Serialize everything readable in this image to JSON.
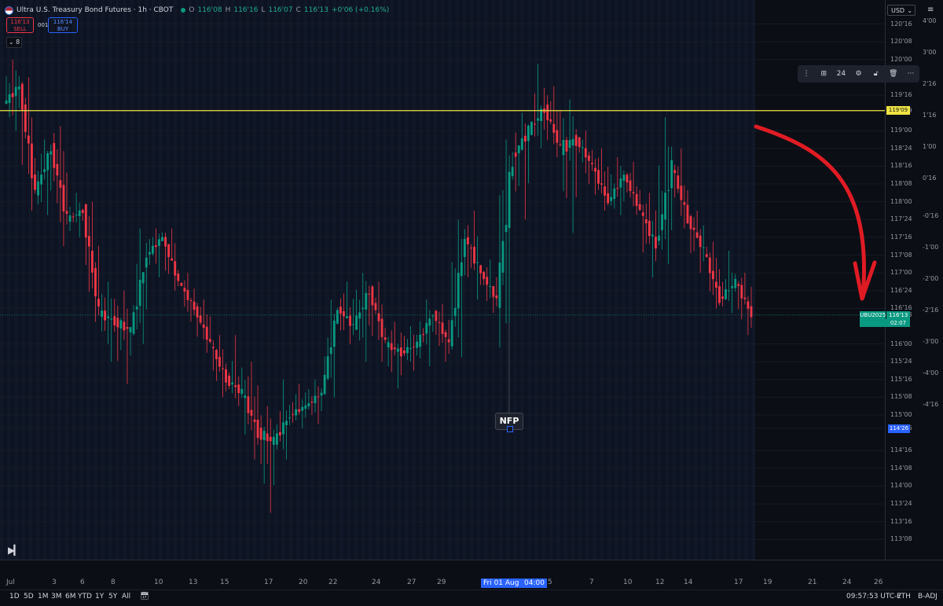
{
  "legend": {
    "title": "Ultra U.S. Treasury Bond Futures · 1h · CBOT",
    "open_label": "O",
    "open": "116'08",
    "high_label": "H",
    "high": "116'16",
    "low_label": "L",
    "low": "116'07",
    "close_label": "C",
    "close": "116'13",
    "change": "+0'06 (+0.16%)"
  },
  "trade": {
    "sell_price": "116'13",
    "sell_label": "SELL",
    "spread": "001",
    "buy_price": "116'14",
    "buy_label": "BUY",
    "indicator_count": "8"
  },
  "currency": "USD",
  "toolbar": {
    "line_width": "24"
  },
  "colors": {
    "background": "#0b0e14",
    "up": "#089981",
    "down": "#f23645",
    "horizontal_line": "#f0e442",
    "arrow": "#e01b24",
    "session_band": "#101828",
    "accent": "#2962ff"
  },
  "chart_data": {
    "type": "candlestick",
    "title": "Ultra U.S. Treasury Bond Futures · 1h · CBOT",
    "y_unit": "32nds of a point",
    "ylim": [
      "113'04",
      "120'24"
    ],
    "y_ticks": [
      "120'16",
      "120'08",
      "120'00",
      "119'16",
      "119'09",
      "119'00",
      "118'24",
      "118'16",
      "118'08",
      "118'00",
      "117'24",
      "117'16",
      "117'08",
      "117'00",
      "116'24",
      "116'16",
      "116'13",
      "116'00",
      "115'24",
      "115'16",
      "115'08",
      "115'00",
      "114'26",
      "114'16",
      "114'08",
      "114'00",
      "113'24",
      "113'16",
      "113'08"
    ],
    "y2_ticks": [
      "4'00",
      "3'00",
      "2'16",
      "1'16",
      "1'00",
      "0'16",
      "-0'16",
      "-1'00",
      "-2'00",
      "-2'16",
      "-3'00",
      "-4'00",
      "-4'16"
    ],
    "x_ticks": [
      "Jul",
      "3",
      "6",
      "8",
      "10",
      "13",
      "15",
      "17",
      "20",
      "22",
      "24",
      "27",
      "29",
      "Fri 01 Aug '25",
      "04:00",
      "5",
      "7",
      "10",
      "12",
      "14",
      "17",
      "19",
      "21",
      "24",
      "26"
    ],
    "series": [
      {
        "x": "Jul 1",
        "open": "119'12",
        "high": "120'00",
        "low": "119'00",
        "close": "119'20"
      },
      {
        "x": "Jul 2",
        "open": "119'20",
        "high": "119'24",
        "low": "117'28",
        "close": "118'04"
      },
      {
        "x": "Jul 3",
        "open": "118'04",
        "high": "118'28",
        "low": "117'26",
        "close": "118'24"
      },
      {
        "x": "Jul 4",
        "open": "118'24",
        "high": "119'02",
        "low": "117'12",
        "close": "117'24"
      },
      {
        "x": "Jul 5",
        "open": "117'24",
        "high": "118'04",
        "low": "117'16",
        "close": "117'28"
      },
      {
        "x": "Jul 6",
        "open": "117'28",
        "high": "118'00",
        "low": "116'10",
        "close": "116'14"
      },
      {
        "x": "Jul 7",
        "open": "116'14",
        "high": "116'28",
        "low": "115'24",
        "close": "116'10"
      },
      {
        "x": "Jul 8",
        "open": "116'10",
        "high": "116'24",
        "low": "115'14",
        "close": "116'06"
      },
      {
        "x": "Jul 9",
        "open": "116'06",
        "high": "117'20",
        "low": "116'00",
        "close": "117'08"
      },
      {
        "x": "Jul 10",
        "open": "117'08",
        "high": "117'20",
        "low": "116'30",
        "close": "117'16"
      },
      {
        "x": "Jul 11",
        "open": "117'16",
        "high": "117'20",
        "low": "116'24",
        "close": "116'28"
      },
      {
        "x": "Jul 12",
        "open": "116'28",
        "high": "117'00",
        "low": "116'10",
        "close": "116'16"
      },
      {
        "x": "Jul 13",
        "open": "116'16",
        "high": "116'20",
        "low": "115'28",
        "close": "116'00"
      },
      {
        "x": "Jul 14",
        "open": "116'00",
        "high": "116'04",
        "low": "115'08",
        "close": "115'16"
      },
      {
        "x": "Jul 15",
        "open": "115'16",
        "high": "116'04",
        "low": "115'04",
        "close": "115'10"
      },
      {
        "x": "Jul 16",
        "open": "115'10",
        "high": "115'24",
        "low": "114'12",
        "close": "114'24"
      },
      {
        "x": "Jul 16b",
        "open": "114'24",
        "high": "115'04",
        "low": "113'20",
        "close": "114'20"
      },
      {
        "x": "Jul 17",
        "open": "114'20",
        "high": "115'16",
        "low": "114'12",
        "close": "115'00"
      },
      {
        "x": "Jul 18",
        "open": "115'00",
        "high": "115'14",
        "low": "114'26",
        "close": "115'04"
      },
      {
        "x": "Jul 20",
        "open": "115'04",
        "high": "115'16",
        "low": "114'28",
        "close": "115'10"
      },
      {
        "x": "Jul 21",
        "open": "115'10",
        "high": "116'20",
        "low": "115'08",
        "close": "116'16"
      },
      {
        "x": "Jul 22",
        "open": "116'16",
        "high": "116'28",
        "low": "116'00",
        "close": "116'08"
      },
      {
        "x": "Jul 23",
        "open": "116'08",
        "high": "117'00",
        "low": "115'24",
        "close": "116'24"
      },
      {
        "x": "Jul 24",
        "open": "116'24",
        "high": "116'28",
        "low": "115'24",
        "close": "116'00"
      },
      {
        "x": "Jul 25",
        "open": "116'00",
        "high": "116'10",
        "low": "115'12",
        "close": "115'28"
      },
      {
        "x": "Jul 27",
        "open": "115'28",
        "high": "116'08",
        "low": "115'20",
        "close": "116'00"
      },
      {
        "x": "Jul 28",
        "open": "116'00",
        "high": "116'20",
        "low": "115'22",
        "close": "116'14"
      },
      {
        "x": "Jul 29",
        "open": "116'14",
        "high": "116'18",
        "low": "115'24",
        "close": "116'00"
      },
      {
        "x": "Jul 30",
        "open": "116'00",
        "high": "117'24",
        "low": "115'26",
        "close": "117'16"
      },
      {
        "x": "Jul 31",
        "open": "117'16",
        "high": "117'28",
        "low": "116'20",
        "close": "117'00"
      },
      {
        "x": "Aug 1 am",
        "open": "117'00",
        "high": "117'06",
        "low": "116'14",
        "close": "116'20"
      },
      {
        "x": "Aug 1 NFP",
        "open": "116'20",
        "high": "118'28",
        "low": "115'08",
        "close": "118'20"
      },
      {
        "x": "Aug 4",
        "open": "118'20",
        "high": "119'08",
        "low": "117'24",
        "close": "119'00"
      },
      {
        "x": "Aug 5",
        "open": "119'00",
        "high": "119'30",
        "low": "118'24",
        "close": "119'10"
      },
      {
        "x": "Aug 6",
        "open": "119'10",
        "high": "119'20",
        "low": "118'20",
        "close": "118'24"
      },
      {
        "x": "Aug 7",
        "open": "118'24",
        "high": "119'14",
        "low": "117'18",
        "close": "118'28"
      },
      {
        "x": "Aug 8",
        "open": "118'28",
        "high": "119'00",
        "low": "118'08",
        "close": "118'16"
      },
      {
        "x": "Aug 10",
        "open": "118'16",
        "high": "118'24",
        "low": "117'28",
        "close": "118'00"
      },
      {
        "x": "Aug 11",
        "open": "118'00",
        "high": "118'20",
        "low": "117'26",
        "close": "118'12"
      },
      {
        "x": "Aug 12",
        "open": "118'12",
        "high": "118'18",
        "low": "117'26",
        "close": "117'28"
      },
      {
        "x": "Aug 13",
        "open": "117'28",
        "high": "118'04",
        "low": "116'30",
        "close": "117'12"
      },
      {
        "x": "Aug 14",
        "open": "117'12",
        "high": "119'06",
        "low": "117'04",
        "close": "118'16"
      },
      {
        "x": "Aug 15",
        "open": "118'16",
        "high": "118'24",
        "low": "117'20",
        "close": "117'24"
      },
      {
        "x": "Aug 15b",
        "open": "117'24",
        "high": "117'28",
        "low": "117'00",
        "close": "117'10"
      },
      {
        "x": "Aug 16",
        "open": "117'10",
        "high": "117'14",
        "low": "116'16",
        "close": "116'20"
      },
      {
        "x": "Aug 17",
        "open": "116'20",
        "high": "117'10",
        "low": "116'14",
        "close": "116'28"
      },
      {
        "x": "Aug 18",
        "open": "116'28",
        "high": "117'00",
        "low": "116'04",
        "close": "116'13"
      }
    ],
    "horizontal_line": {
      "price": "119'09"
    },
    "current_price": {
      "symbol": "UBU2025",
      "price": "116'13",
      "countdown": "02:07"
    },
    "axis_marker": "114'26",
    "annotation": "NFP",
    "grid": true
  },
  "timeframes": [
    "1D",
    "5D",
    "1M",
    "3M",
    "6M",
    "YTD",
    "1Y",
    "5Y",
    "All"
  ],
  "status": {
    "time": "09:57:53 UTC-7",
    "session": "ETH",
    "adjustment": "B-ADJ"
  }
}
